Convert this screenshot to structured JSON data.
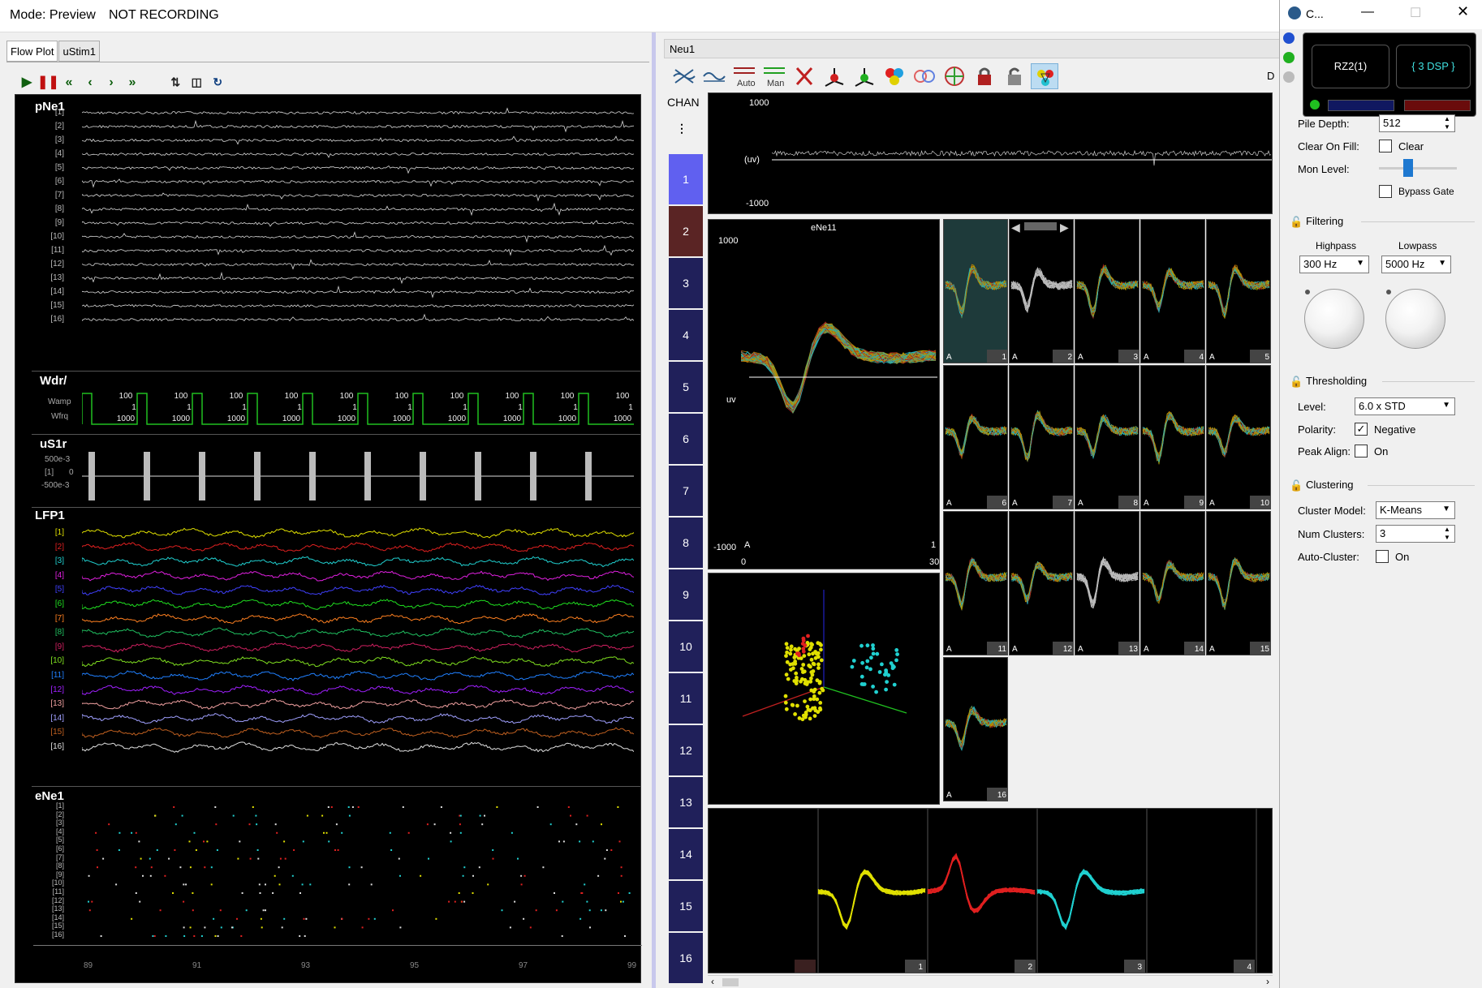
{
  "top": {
    "mode": "Mode: Preview",
    "recording": "NOT RECORDING"
  },
  "left": {
    "tabs": [
      {
        "label": "Flow Plot"
      },
      {
        "label": "uStim1"
      }
    ],
    "sections": {
      "pne1": "pNe1",
      "wdr": "Wdr/",
      "us1r": "uS1r",
      "lfp1": "LFP1",
      "ene1": "eNe1"
    },
    "wdr_labels": {
      "wamp": "Wamp",
      "wfrq": "Wfrq"
    },
    "wdr_values": {
      "top": "100",
      "mid": "1",
      "bot": "1000"
    },
    "us1r_labels": {
      "top": "500e-3",
      "ch": "[1]",
      "zero": "0",
      "bot": "-500e-3"
    },
    "channels": [
      "[1]",
      "[2]",
      "[3]",
      "[4]",
      "[5]",
      "[6]",
      "[7]",
      "[8]",
      "[9]",
      "[10]",
      "[11]",
      "[12]",
      "[13]",
      "[14]",
      "[15]",
      "[16]"
    ],
    "lfp_colors": [
      "#e0e000",
      "#e02020",
      "#20d0d0",
      "#e020e0",
      "#4040ff",
      "#20e020",
      "#ff8020",
      "#20c060",
      "#d02060",
      "#80e020",
      "#2080ff",
      "#a020ff",
      "#f0a0a0",
      "#a0a0ff",
      "#c06020",
      "#e0e0e0"
    ],
    "x_ticks": [
      "89",
      "91",
      "93",
      "95",
      "97",
      "99"
    ]
  },
  "neu": {
    "title": "Neu1",
    "chan_label": "CHAN",
    "chans": [
      "1",
      "2",
      "3",
      "4",
      "5",
      "6",
      "7",
      "8",
      "9",
      "10",
      "11",
      "12",
      "13",
      "14",
      "15",
      "16"
    ],
    "stream": {
      "top": "1000",
      "unit": "(uv)",
      "bot": "-1000"
    },
    "spike": {
      "title": "eNe11",
      "top": "1000",
      "unit": "uv",
      "bot": "-1000",
      "x0": "0",
      "x1": "30",
      "corner_a": "A",
      "corner_n": "1"
    },
    "grid_labels": [
      "1",
      "2",
      "3",
      "4",
      "5",
      "6",
      "7",
      "8",
      "9",
      "10",
      "11",
      "12",
      "13",
      "14",
      "15",
      "16"
    ],
    "grid_a": "A",
    "clusters": {
      "labels": [
        "1",
        "2",
        "3",
        "4"
      ],
      "colors": [
        "#e0e000",
        "#e02020",
        "#20d0d0"
      ]
    }
  },
  "right": {
    "title": "C...",
    "device": {
      "name": "RZ2(1)",
      "dsp": "{ 3 DSP }"
    },
    "side_label": "D",
    "pile_depth": {
      "label": "Pile Depth:",
      "value": "512"
    },
    "clear_on_fill": {
      "label": "Clear On Fill:",
      "check": "Clear"
    },
    "mon_level": {
      "label": "Mon Level:"
    },
    "bypass": "Bypass Gate",
    "filtering": {
      "title": "Filtering",
      "highpass": {
        "label": "Highpass",
        "value": "300 Hz"
      },
      "lowpass": {
        "label": "Lowpass",
        "value": "5000 Hz"
      }
    },
    "thresholding": {
      "title": "Thresholding",
      "level": {
        "label": "Level:",
        "value": "6.0 x STD"
      },
      "polarity": {
        "label": "Polarity:",
        "value": "Negative"
      },
      "peak_align": {
        "label": "Peak Align:",
        "value": "On"
      }
    },
    "clustering": {
      "title": "Clustering",
      "model": {
        "label": "Cluster Model:",
        "value": "K-Means"
      },
      "num": {
        "label": "Num Clusters:",
        "value": "3"
      },
      "auto": {
        "label": "Auto-Cluster:",
        "value": "On"
      }
    }
  }
}
